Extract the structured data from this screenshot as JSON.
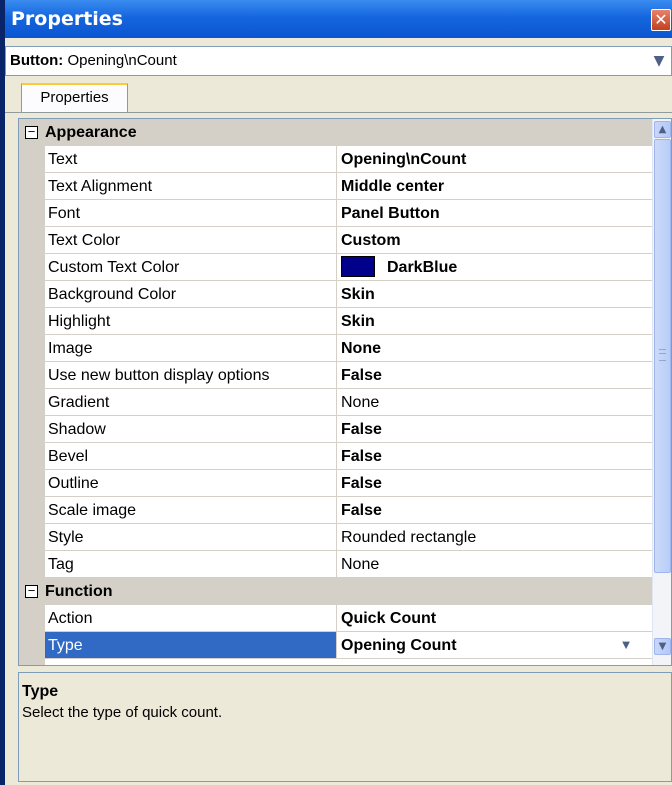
{
  "window": {
    "title": "Properties",
    "close_glyph": "✕"
  },
  "selector": {
    "type_label": "Button:",
    "object_name": "Opening\\nCount",
    "dropdown_icon": "chevron-down-icon"
  },
  "tabs": [
    {
      "label": "Properties",
      "active": true
    }
  ],
  "grid": {
    "categories": [
      {
        "label": "Appearance",
        "expanded": true,
        "properties": [
          {
            "name": "Text",
            "value": "Opening\\nCount",
            "bold": true
          },
          {
            "name": "Text Alignment",
            "value": "Middle center",
            "bold": true
          },
          {
            "name": "Font",
            "value": "Panel Button",
            "bold": true
          },
          {
            "name": "Text Color",
            "value": "Custom",
            "bold": true
          },
          {
            "name": "Custom Text Color",
            "value": "DarkBlue",
            "bold": true,
            "swatch_color": "#00008b"
          },
          {
            "name": "Background Color",
            "value": "Skin",
            "bold": true
          },
          {
            "name": "Highlight",
            "value": "Skin",
            "bold": true
          },
          {
            "name": "Image",
            "value": "None",
            "bold": true
          },
          {
            "name": "Use new button display options",
            "value": "False",
            "bold": true
          },
          {
            "name": "Gradient",
            "value": "None",
            "bold": false
          },
          {
            "name": "Shadow",
            "value": "False",
            "bold": true
          },
          {
            "name": "Bevel",
            "value": "False",
            "bold": true
          },
          {
            "name": "Outline",
            "value": "False",
            "bold": true
          },
          {
            "name": "Scale image",
            "value": "False",
            "bold": true
          },
          {
            "name": "Style",
            "value": "Rounded rectangle",
            "bold": false
          },
          {
            "name": "Tag",
            "value": "None",
            "bold": false
          }
        ]
      },
      {
        "label": "Function",
        "expanded": true,
        "properties": [
          {
            "name": "Action",
            "value": "Quick Count",
            "bold": true
          },
          {
            "name": "Type",
            "value": "Opening Count",
            "bold": true,
            "selected": true
          }
        ]
      }
    ],
    "collapse_glyph": "⊟"
  },
  "help": {
    "title": "Type",
    "description": "Select the type of quick count."
  },
  "colors": {
    "titlebar": "#0b55d0",
    "selection": "#316ac5",
    "category_bg": "#d4d0c8",
    "swatch": "#00008b"
  }
}
